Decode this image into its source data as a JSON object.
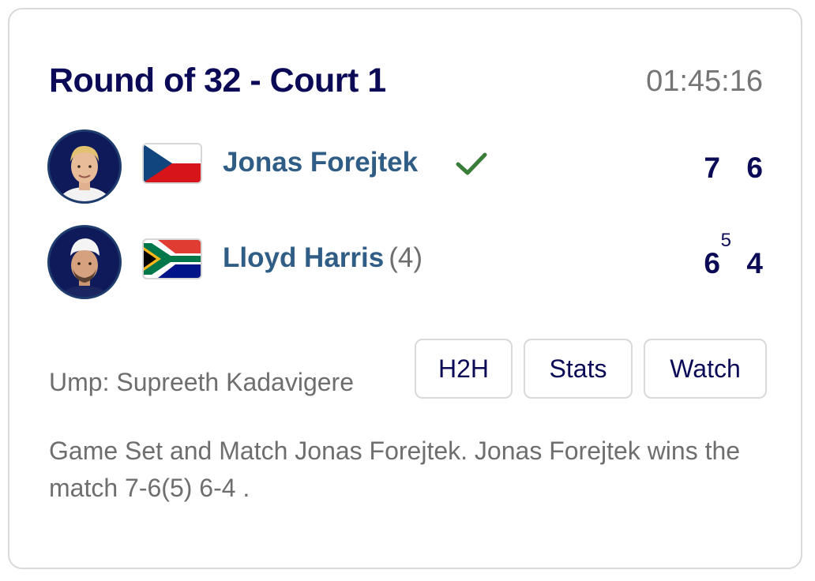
{
  "match": {
    "title": "Round of 32 - Court 1",
    "duration": "01:45:16"
  },
  "players": [
    {
      "name": "Jonas Forejtek",
      "seed": "",
      "country_flag": "czech-republic",
      "winner": true,
      "sets": [
        "7",
        "6"
      ],
      "tiebreak": ""
    },
    {
      "name": "Lloyd Harris",
      "seed": "(4)",
      "country_flag": "south-africa",
      "winner": false,
      "sets": [
        "6",
        "4"
      ],
      "tiebreak": "5"
    }
  ],
  "umpire": "Ump: Supreeth Kadavigere",
  "actions": {
    "h2h": "H2H",
    "stats": "Stats",
    "watch": "Watch"
  },
  "summary": "Game Set and Match Jonas Forejtek. Jonas Forejtek wins the match 7-6(5) 6-4 .",
  "icons": {
    "winner": "checkmark-icon"
  },
  "colors": {
    "title": "#0b0a57",
    "player_name": "#2f5d86",
    "winner_check": "#3a7d3a",
    "muted_text": "#6e6e6e",
    "border": "#d9d9d9"
  }
}
